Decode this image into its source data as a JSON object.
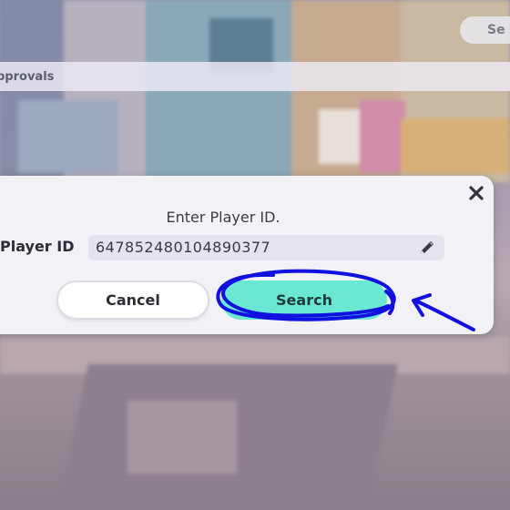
{
  "background": {
    "strip_label": "pprovals",
    "top_pill_label": "Se"
  },
  "dialog": {
    "title": "Enter Player ID.",
    "field_label": "Player ID",
    "field_value": "647852480104890377",
    "cancel_label": "Cancel",
    "search_label": "Search"
  },
  "icons": {
    "close": "close-icon",
    "edit": "pencil-icon"
  },
  "colors": {
    "search_button": "#6ae8d4",
    "annotation": "#1010e0",
    "dialog_bg": "#f2f2f6"
  }
}
